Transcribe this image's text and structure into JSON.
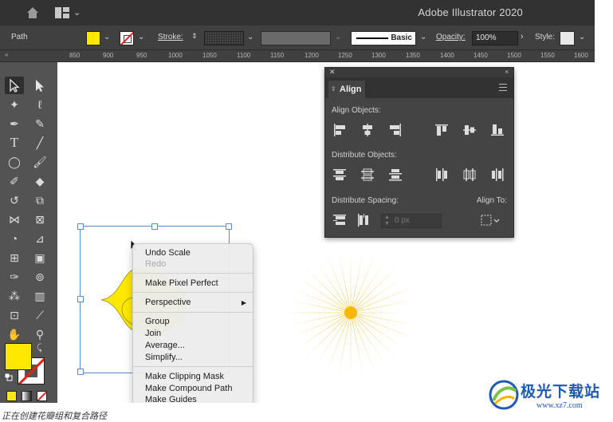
{
  "window": {
    "app_title": "Adobe Illustrator 2020",
    "home_icon": "home-icon",
    "workspace_icon": "workspace-switcher-icon"
  },
  "control_bar": {
    "selection_label": "Path",
    "fill_color": "#ffe800",
    "stroke_label": "Stroke:",
    "brush_label": "Basic",
    "opacity_label": "Opacity:",
    "opacity_value": "100%",
    "style_label": "Style:"
  },
  "ruler": {
    "ticks": [
      "850",
      "900",
      "950",
      "1000",
      "1050",
      "1100",
      "1150",
      "1200",
      "1250",
      "1300",
      "1350",
      "1400",
      "1450",
      "1500",
      "1550",
      "1600"
    ]
  },
  "align_panel": {
    "tab_label": "Align",
    "sections": {
      "align_objects": "Align Objects:",
      "distribute_objects": "Distribute Objects:",
      "distribute_spacing": "Distribute Spacing:",
      "align_to": "Align To:"
    },
    "spacing_value": "0 px"
  },
  "context_menu": {
    "items": [
      {
        "label": "Undo Scale",
        "enabled": true
      },
      {
        "label": "Redo",
        "enabled": false
      },
      {
        "label": "Make Pixel Perfect",
        "enabled": true
      },
      {
        "label": "Perspective",
        "enabled": true,
        "submenu": true
      },
      {
        "label": "Group",
        "enabled": true
      },
      {
        "label": "Join",
        "enabled": true
      },
      {
        "label": "Average...",
        "enabled": true
      },
      {
        "label": "Simplify...",
        "enabled": true
      },
      {
        "label": "Make Clipping Mask",
        "enabled": true
      },
      {
        "label": "Make Compound Path",
        "enabled": true
      },
      {
        "label": "Make Guides",
        "enabled": true
      }
    ]
  },
  "artwork": {
    "flower_color": "#ffe800",
    "sunburst_color": "#f9b800"
  },
  "watermark": {
    "text": "极光下载站",
    "url": "www.xz7.com"
  },
  "caption": "正在创建花瓣组和复合路径"
}
